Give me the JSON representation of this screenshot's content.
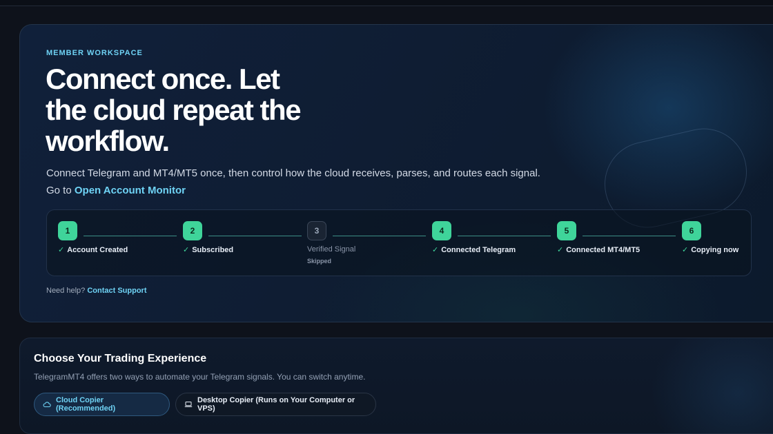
{
  "hero": {
    "eyebrow": "MEMBER WORKSPACE",
    "title": "Connect once. Let the cloud repeat the workflow.",
    "subtitle_text": "Connect Telegram and MT4/MT5 once, then control how the cloud receives, parses, and routes each signal. Go to ",
    "subtitle_link": "Open Account Monitor",
    "help_text": "Need help?",
    "help_link": "Contact Support"
  },
  "steps": [
    {
      "number": "1",
      "label": "Account Created",
      "status": "done"
    },
    {
      "number": "2",
      "label": "Subscribed",
      "status": "done"
    },
    {
      "number": "3",
      "label": "Verified Signal",
      "status": "skipped",
      "sub": "Skipped"
    },
    {
      "number": "4",
      "label": "Connected Telegram",
      "status": "done"
    },
    {
      "number": "5",
      "label": "Connected MT4/MT5",
      "status": "done"
    },
    {
      "number": "6",
      "label": "Copying now",
      "status": "done"
    }
  ],
  "experience": {
    "title": "Choose Your Trading Experience",
    "subtitle": "TelegramMT4 offers two ways to automate your Telegram signals. You can switch anytime.",
    "tabs": [
      {
        "label": "Cloud Copier (Recommended)",
        "icon": "cloud-icon",
        "active": true
      },
      {
        "label": "Desktop Copier (Runs on Your Computer or VPS)",
        "icon": "laptop-icon",
        "active": false
      }
    ]
  },
  "colors": {
    "accent": "#6fd3f5",
    "success": "#3fd49a",
    "background": "#0e121b"
  }
}
